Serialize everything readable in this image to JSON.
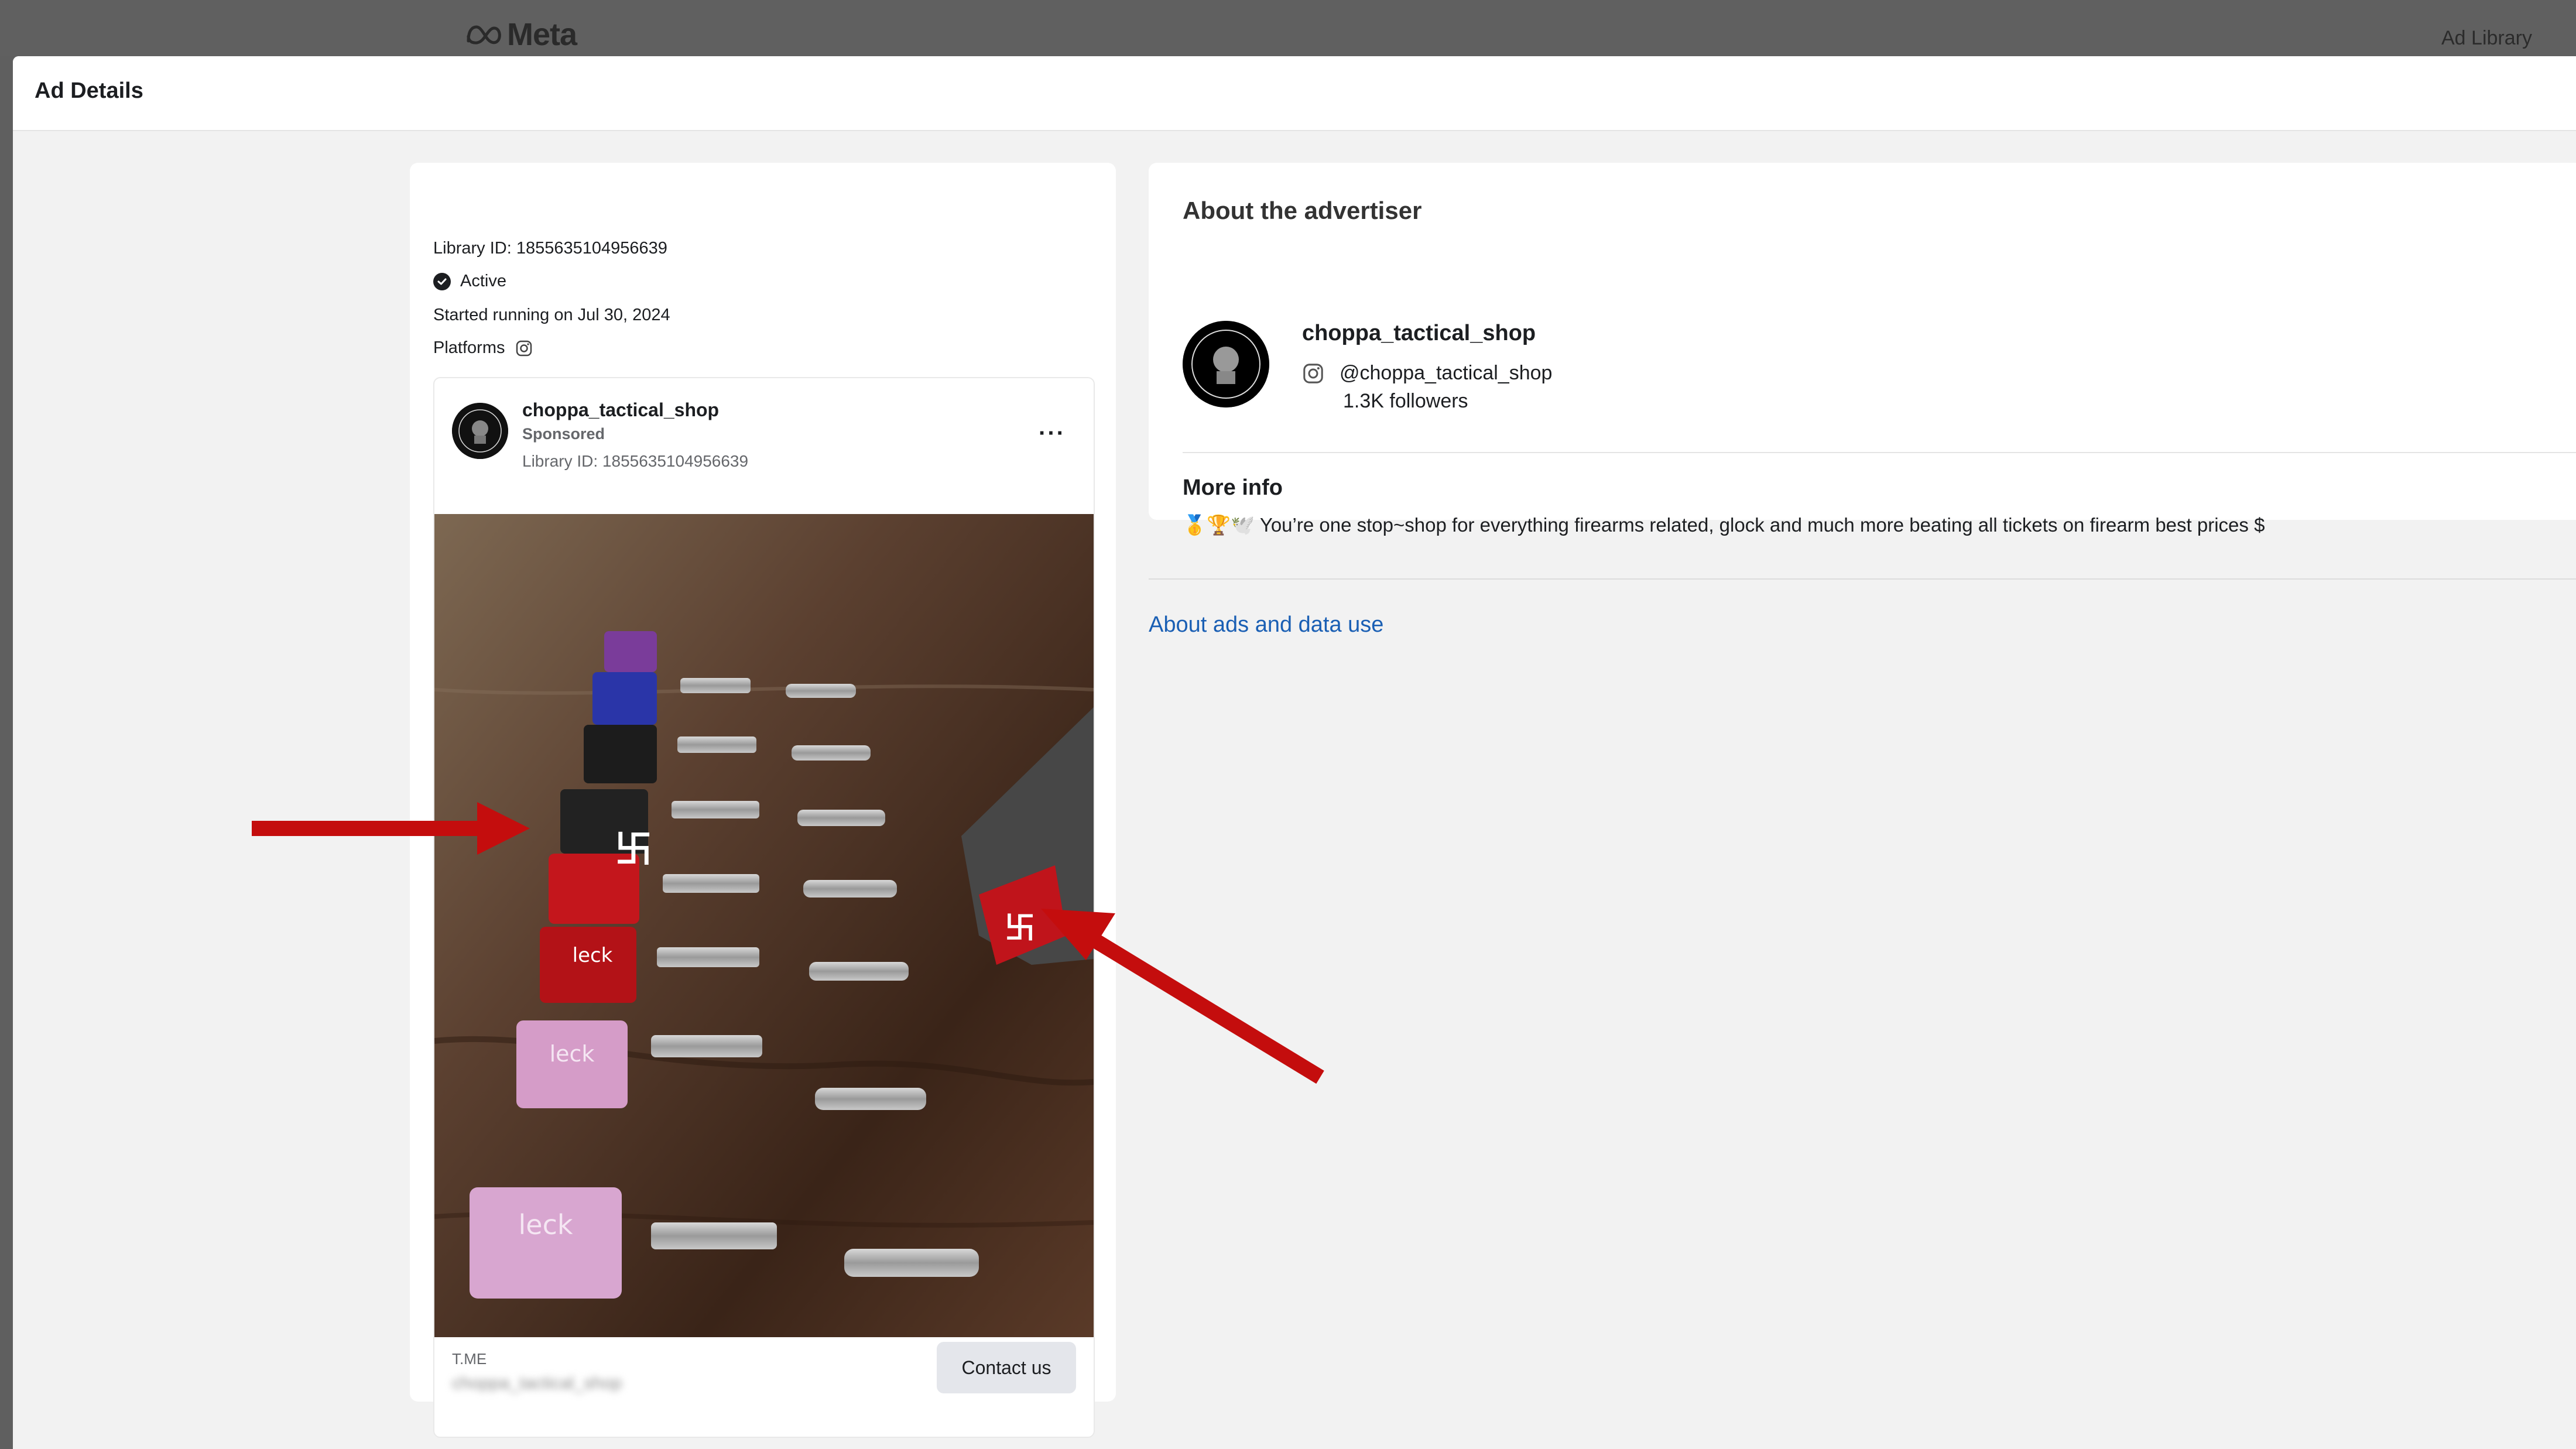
{
  "topbar": {
    "logo_text": "Meta",
    "ad_library_label": "Ad Library"
  },
  "modal": {
    "title": "Ad Details"
  },
  "ad_meta": {
    "library_id": "Library ID: 1855635104956639",
    "status": "Active",
    "started": "Started running on Jul 30, 2024",
    "platforms_label": "Platforms"
  },
  "ad": {
    "page_name": "choppa_tactical_shop",
    "sponsored": "Sponsored",
    "library_id": "Library ID: 1855635104956639",
    "more_icon": "more-horizontal-icon",
    "footer_domain": "T.ME",
    "footer_link_blurred": "choppa_tactical_shop",
    "cta_label": "Contact us"
  },
  "advertiser": {
    "section_title": "About the advertiser",
    "name": "choppa_tactical_shop",
    "handle": "@choppa_tactical_shop",
    "followers": "1.3K followers",
    "more_info_title": "More info",
    "more_info_text": "🥇🏆🕊️ You’re one stop~shop for everything firearms related, glock and much more beating all tickets on firearm best prices $"
  },
  "links": {
    "about_ads": "About ads and data use"
  },
  "colors": {
    "link": "#1a5fb4",
    "arrow": "#c40d0d",
    "button_bg": "#e4e6eb"
  }
}
